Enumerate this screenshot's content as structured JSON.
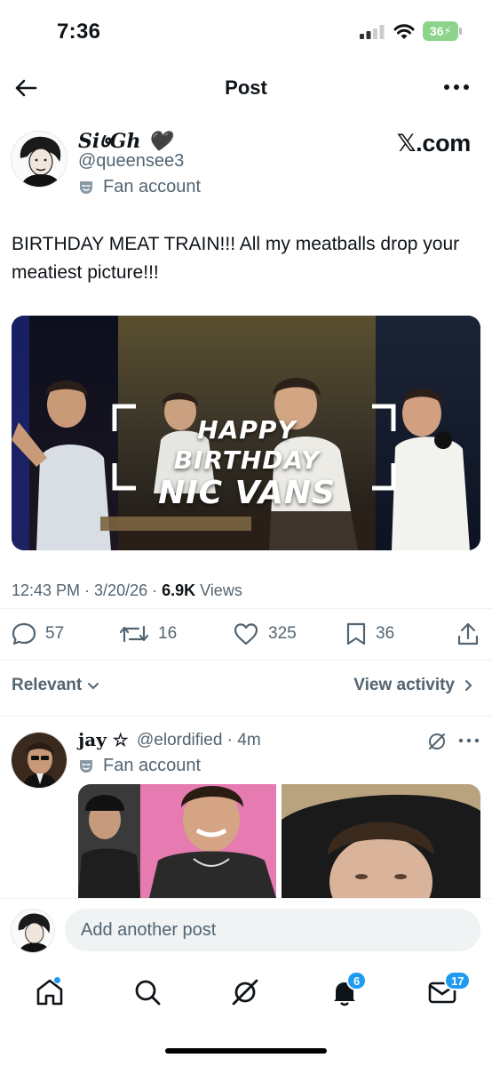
{
  "status_bar": {
    "time": "7:36",
    "battery": "36"
  },
  "header": {
    "title": "Post",
    "back_icon": "arrow-left-icon",
    "more_icon": "more-horizontal-icon"
  },
  "post": {
    "author_name": "Si७Gh 🖤",
    "author_handle": "@queensee3",
    "account_label": "Fan account",
    "source": "𝕏.com",
    "text": "BIRTHDAY MEAT TRAIN!!! All my meatballs drop your meatiest picture!!!",
    "image_caption_line1": "HAPPY BIRTHDAY",
    "image_caption_line2": "NIC VANS",
    "time": "12:43 PM · 3/20/26 · ",
    "views_count": "6.9K",
    "views_label": " Views",
    "replies": "57",
    "reposts": "16",
    "likes": "325",
    "bookmarks": "36"
  },
  "sort": {
    "label": "Relevant",
    "view_activity": "View activity"
  },
  "reply": {
    "author_name": "jay ☆",
    "author_meta": "@elordified · 4m",
    "account_label": "Fan account"
  },
  "composer": {
    "placeholder": "Add another post"
  },
  "tabbar": {
    "notifications_badge": "6",
    "messages_badge": "17"
  },
  "colors": {
    "accent": "#1d9bf0",
    "text": "#0f1419",
    "secondary": "#536471"
  }
}
